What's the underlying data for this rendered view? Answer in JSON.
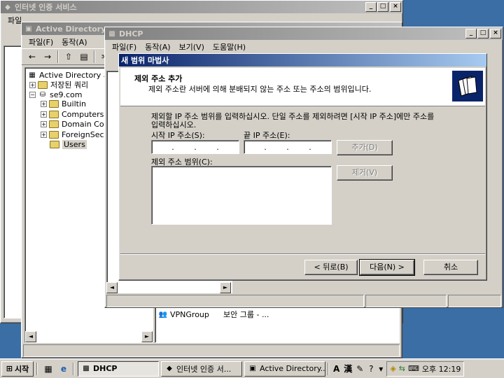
{
  "windows": {
    "ias": {
      "title": "인터넷 인증 서비스",
      "menu": [
        "파일"
      ]
    },
    "ad": {
      "title": "Active Directory",
      "menu": [
        "파일(F)",
        "동작(A)"
      ],
      "tree": {
        "root": "Active Directory 사",
        "saved_query": "저장된 쿼리",
        "domain": "se9.com",
        "items": [
          "Builtin",
          "Computers",
          "Domain Co",
          "ForeignSec",
          "Users"
        ]
      },
      "list_row": {
        "name": "VPNGroup",
        "type": "보안 그룹 - ..."
      }
    },
    "dhcp": {
      "title": "DHCP",
      "menu": [
        "파일(F)",
        "동작(A)",
        "보기(V)",
        "도움말(H)"
      ]
    }
  },
  "wizard": {
    "title": "새 범위 마법사",
    "header_title": "제외 주소 추가",
    "header_desc": "제외 주소란 서버에 의해 분배되지 않는 주소 또는 주소의 범위입니다.",
    "instruction_line1": "제외할 IP 주소 범위를 입력하십시오. 단일 주소를 제외하려면 [시작 IP 주소]에만 주소를",
    "instruction_line2": "입력하십시오.",
    "start_ip_label": "시작 IP 주소(S):",
    "end_ip_label": "끝 IP 주소(E):",
    "add_button": "추가(D)",
    "remove_button": "제거(V)",
    "excluded_range_label": "제외 주소 범위(C):",
    "back_button": "< 뒤로(B)",
    "next_button": "다음(N) >",
    "cancel_button": "취소"
  },
  "taskbar": {
    "start": "시작",
    "tasks": [
      "DHCP",
      "인터넷 인증 서...",
      "Active Directory..."
    ],
    "ime_a": "A",
    "ime_han": "漢",
    "time": "오후 12:19"
  },
  "colors": {
    "desktop": "#3a6ea5",
    "title_active": "#0a246a",
    "title_inactive": "#808080",
    "face": "#d4d0c8"
  }
}
